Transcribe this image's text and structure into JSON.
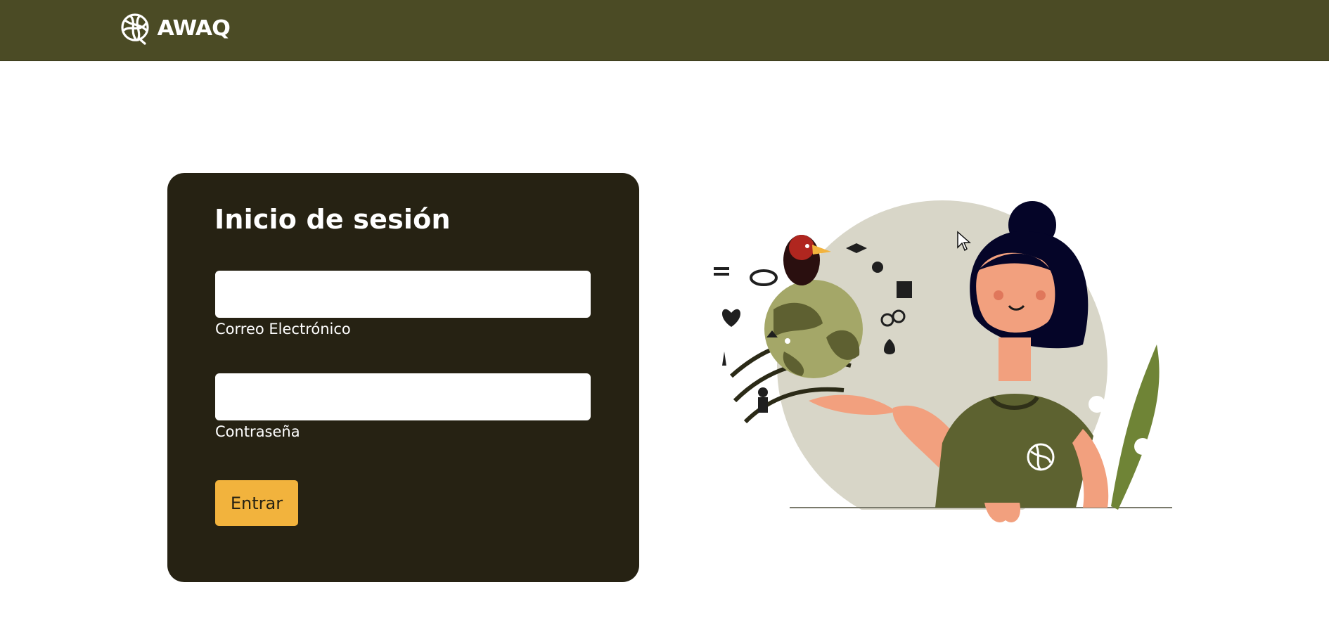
{
  "header": {
    "logo_text": "AWAQ",
    "logo_icon": "awaq-globe-icon",
    "background_color": "#4b4b25"
  },
  "login": {
    "title": "Inicio de sesión",
    "email_label": "Correo Electrónico",
    "email_value": "",
    "password_label": "Contraseña",
    "password_value": "",
    "submit_label": "Entrar",
    "card_color": "#262213",
    "button_color": "#f2b33d"
  },
  "illustration": {
    "subject": "woman-holding-globe-illustration",
    "accent_color": "#5d6230"
  }
}
